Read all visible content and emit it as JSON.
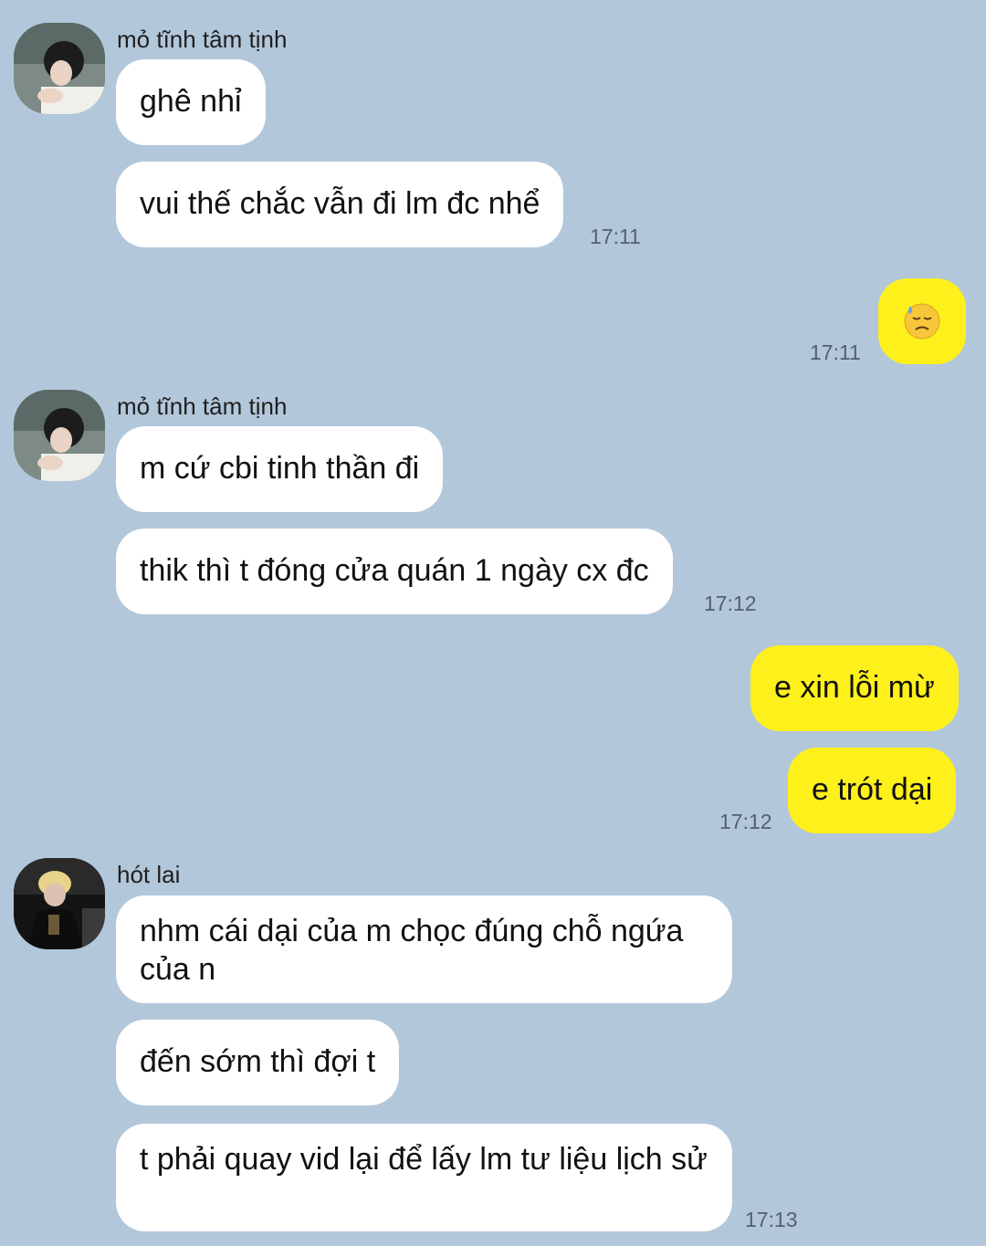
{
  "colors": {
    "background": "#b2c7da",
    "bubble_incoming": "#ffffff",
    "bubble_outgoing": "#fef01b",
    "timestamp": "#55606b"
  },
  "messages": [
    {
      "sender": "mỏ tĩnh tâm tịnh",
      "avatar": "avatar-girl-photo",
      "bubbles": [
        "ghê nhỉ",
        "vui thế chắc vẫn đi lm đc nhể"
      ],
      "time": "17:11"
    },
    {
      "sender": "me",
      "emoji": "downcast-face-with-sweat-icon",
      "time": "17:11"
    },
    {
      "sender": "mỏ tĩnh tâm tịnh",
      "avatar": "avatar-girl-photo",
      "bubbles": [
        "m cứ cbi tinh thần đi",
        "thik thì t đóng cửa quán 1 ngày cx đc"
      ],
      "time": "17:12"
    },
    {
      "sender": "me",
      "bubbles": [
        "e xin lỗi mừ",
        "e trót dại"
      ],
      "time": "17:12"
    },
    {
      "sender": "hót lai",
      "avatar": "avatar-blond-photo",
      "bubbles": [
        "nhm cái dại của m chọc đúng chỗ ngứa của n",
        "đến sớm thì đợi t",
        "t phải quay vid lại để lấy lm tư liệu lịch sử"
      ],
      "time": "17:13"
    }
  ]
}
